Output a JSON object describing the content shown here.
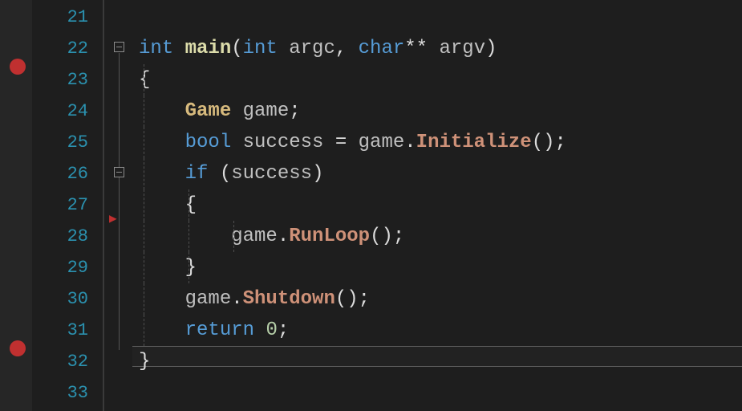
{
  "editor": {
    "lines": [
      "21",
      "22",
      "23",
      "24",
      "25",
      "26",
      "27",
      "28",
      "29",
      "30",
      "31",
      "32",
      "33"
    ],
    "code": {
      "22": {
        "t0": "int ",
        "t1": "main",
        "t2": "(",
        "t3": "int ",
        "t4": "argc",
        "t5": ", ",
        "t6": "char",
        "t7": "** ",
        "t8": "argv",
        "t9": ")"
      },
      "23": {
        "t0": "{"
      },
      "24": {
        "t0": "Game ",
        "t1": "game",
        "t2": ";"
      },
      "25": {
        "t0": "bool ",
        "t1": "success ",
        "t2": "= ",
        "t3": "game",
        "t4": ".",
        "t5": "Initialize",
        "t6": "();"
      },
      "26": {
        "t0": "if ",
        "t1": "(",
        "t2": "success",
        "t3": ")"
      },
      "27": {
        "t0": "{"
      },
      "28": {
        "t0": "game",
        "t1": ".",
        "t2": "RunLoop",
        "t3": "();"
      },
      "29": {
        "t0": "}"
      },
      "30": {
        "t0": "game",
        "t1": ".",
        "t2": "Shutdown",
        "t3": "();"
      },
      "31": {
        "t0": "return ",
        "t1": "0",
        "t2": ";"
      },
      "32": {
        "t0": "}"
      }
    }
  }
}
